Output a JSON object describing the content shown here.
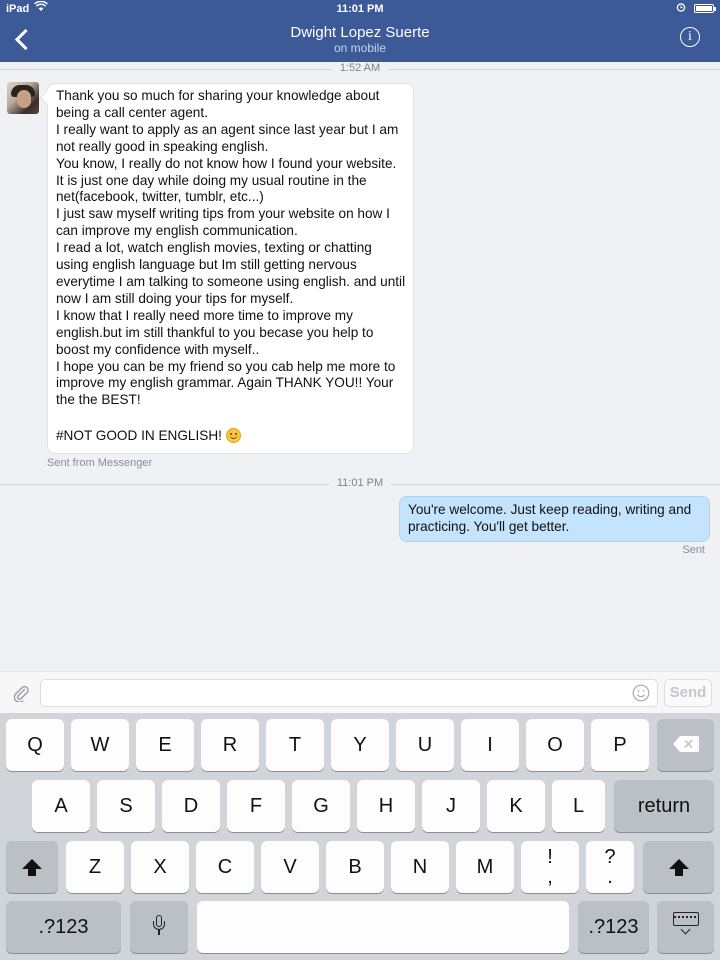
{
  "status_bar": {
    "carrier": "iPad",
    "time": "11:01 PM"
  },
  "nav": {
    "title": "Dwight Lopez Suerte",
    "subtitle": "on mobile",
    "info_label": "i"
  },
  "conversation": {
    "separators": [
      "1:52 AM",
      "11:01 PM"
    ],
    "incoming": {
      "paragraphs": [
        "Thank you so much for sharing your knowledge about being a call center agent.",
        "I really want to apply as an agent since last year but I am not really good in speaking english.",
        "You know, I really do not know how I found your website. It is just one day while doing my usual routine in the net(facebook, twitter, tumblr, etc...)",
        "I just saw myself writing tips from your website on how I can improve my english communication.",
        "I read a lot, watch english movies, texting or chatting using english language but Im still getting nervous everytime I am talking to someone using english.  and until now I am still doing your tips for myself.",
        "I know that I really need more time to improve my english.but im still thankful to you becase you help to boost my confidence with myself..",
        "I hope you can be my friend so you cab help me more to improve my english grammar. Again THANK YOU!! Your the the BEST!",
        "",
        "#NOT GOOD IN ENGLISH!"
      ],
      "sent_from": "Sent from Messenger"
    },
    "outgoing": {
      "text": "You're welcome. Just keep reading, writing and practicing. You'll get better.",
      "status": "Sent"
    }
  },
  "composer": {
    "input_value": "",
    "placeholder": "",
    "send_label": "Send"
  },
  "keyboard": {
    "row1": [
      "Q",
      "W",
      "E",
      "R",
      "T",
      "Y",
      "U",
      "I",
      "O",
      "P"
    ],
    "row2": [
      "A",
      "S",
      "D",
      "F",
      "G",
      "H",
      "J",
      "K",
      "L"
    ],
    "row3": [
      "Z",
      "X",
      "C",
      "V",
      "B",
      "N",
      "M"
    ],
    "row3_punct": [
      [
        "!",
        ","
      ],
      [
        "?",
        "."
      ]
    ],
    "return_label": "return",
    "numbers_label": ".?123"
  },
  "colors": {
    "nav_bar": "#3c5998",
    "outgoing_bubble": "#c4e3fd",
    "background": "#f0f1f4",
    "keyboard": "#d1d4d9"
  },
  "icons": [
    "back-chevron-icon",
    "info-icon",
    "paperclip-icon",
    "emoji-icon",
    "shift-icon",
    "delete-icon",
    "microphone-icon",
    "hide-keyboard-icon",
    "wifi-icon",
    "alarm-icon",
    "battery-icon"
  ]
}
